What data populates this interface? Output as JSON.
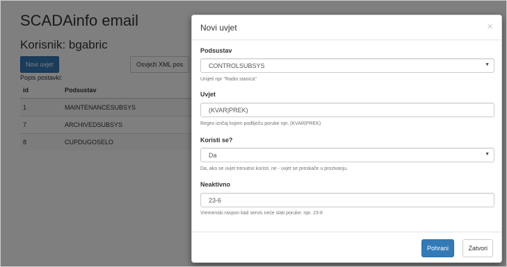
{
  "page": {
    "app_title": "SCADAinfo email",
    "user_title": "Korisnik: bgabric",
    "new_rule_button": "Novi uvjet",
    "refresh_button": "Osvježi XML pos",
    "settings_label": "Popis postavki:",
    "table": {
      "headers": [
        "id",
        "Podsustav"
      ],
      "rows": [
        {
          "id": "1",
          "subsystem": "MAINTENANCESUBSYS"
        },
        {
          "id": "7",
          "subsystem": "ARCHIVEDSUBSYS"
        },
        {
          "id": "8",
          "subsystem": "CUPDUGOSELO"
        }
      ]
    }
  },
  "modal": {
    "title": "Novi uvjet",
    "close_glyph": "×",
    "subsystem": {
      "label": "Podsustav",
      "value": "CONTROLSUBSYS",
      "help": "Unijeti npr \"Radio stanica\""
    },
    "condition": {
      "label": "Uvjet",
      "value": "(KVAR|PREK)",
      "help": "Regex izričaj kojem podliježu poruke npr. (KVAR|PREK)"
    },
    "active": {
      "label": "Koristi se?",
      "value": "Da",
      "help": "Da, ako se uvjet trenutno koristi. ne - uvjet se preskače u prozivanju."
    },
    "inactive": {
      "label": "Neaktivno",
      "value": "23-6",
      "help": "Vremenski raspon kad servis neće slati poruke: npr. 23-6"
    },
    "save_button": "Pohrani",
    "close_button": "Zatvori"
  }
}
